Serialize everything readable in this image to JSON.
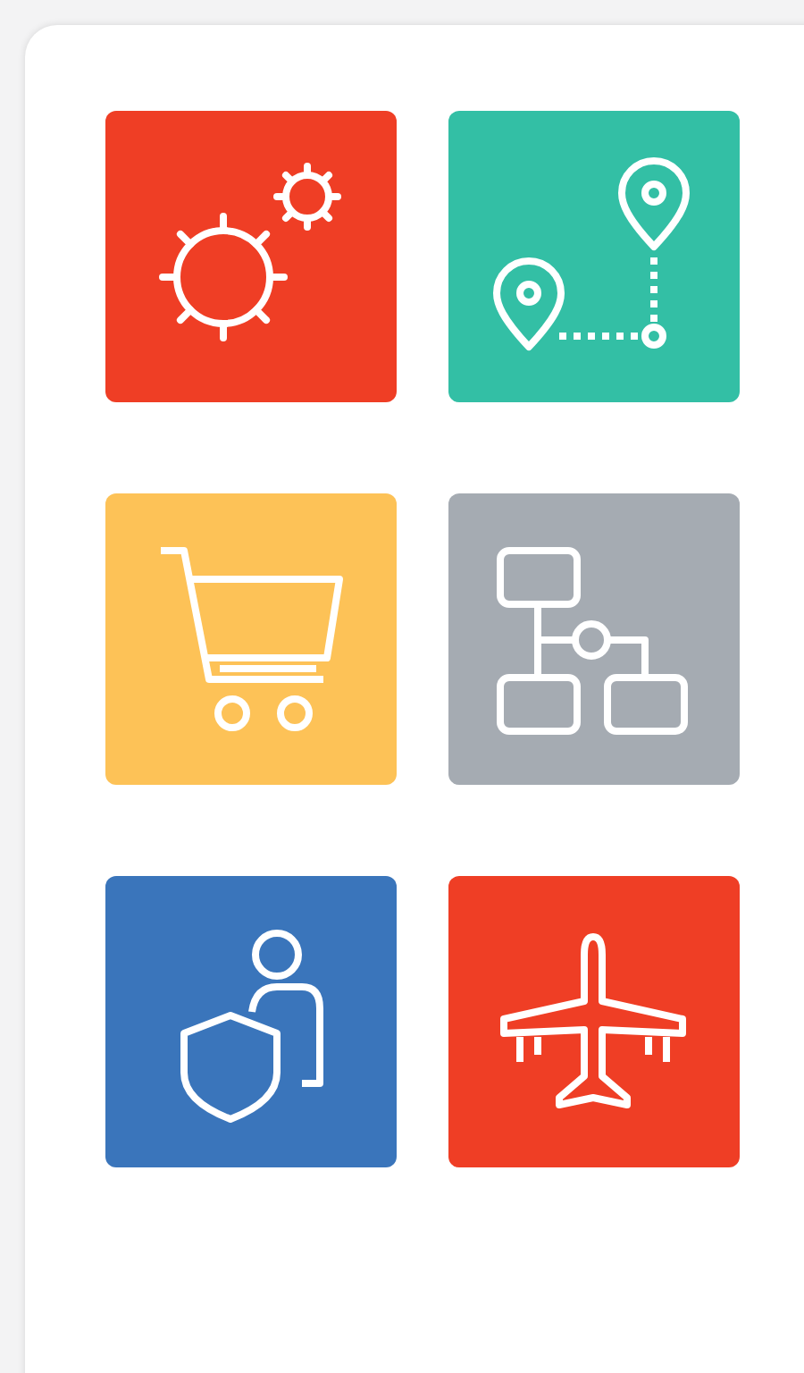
{
  "tiles": [
    {
      "kind": "gears",
      "color": "#ef3e25"
    },
    {
      "kind": "route",
      "color": "#33bfa5"
    },
    {
      "kind": "cart",
      "color": "#fdc257"
    },
    {
      "kind": "flowchart",
      "color": "#a5abb2"
    },
    {
      "kind": "user-shield",
      "color": "#3a75bb"
    },
    {
      "kind": "plane",
      "color": "#ef3e25"
    }
  ]
}
